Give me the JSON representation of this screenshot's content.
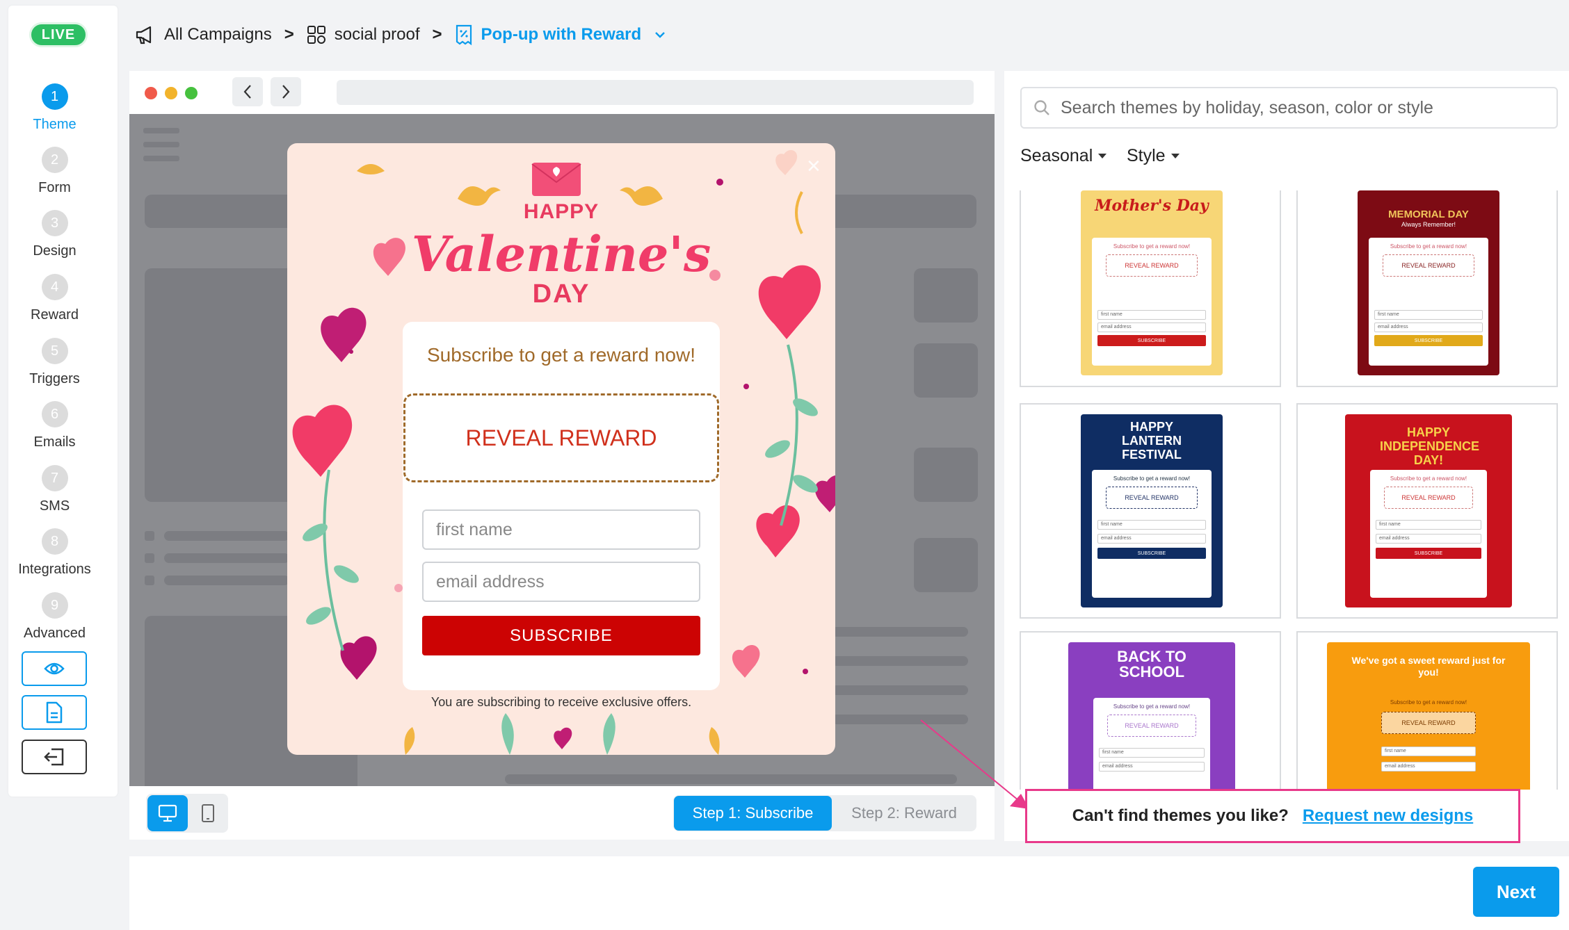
{
  "status_badge": "LIVE",
  "steps": [
    {
      "num": "1",
      "label": "Theme"
    },
    {
      "num": "2",
      "label": "Form"
    },
    {
      "num": "3",
      "label": "Design"
    },
    {
      "num": "4",
      "label": "Reward"
    },
    {
      "num": "5",
      "label": "Triggers"
    },
    {
      "num": "6",
      "label": "Emails"
    },
    {
      "num": "7",
      "label": "SMS"
    },
    {
      "num": "8",
      "label": "Integrations"
    },
    {
      "num": "9",
      "label": "Advanced"
    }
  ],
  "breadcrumb": {
    "all_campaigns": "All Campaigns",
    "folder": "social proof",
    "current": "Pop-up with Reward",
    "separator": ">"
  },
  "popup": {
    "headline_happy": "HAPPY",
    "headline_main": "Valentine's",
    "headline_day": "DAY",
    "subscribe_title": "Subscribe to get a reward now!",
    "reveal_label": "REVEAL REWARD",
    "first_name_placeholder": "first name",
    "email_placeholder": "email address",
    "subscribe_label": "SUBSCRIBE",
    "disclaimer": "You are subscribing to receive exclusive offers."
  },
  "step_tabs": {
    "step1": "Step 1: Subscribe",
    "step2": "Step 2: Reward"
  },
  "themes": {
    "search_placeholder": "Search themes by holiday, season, color or style",
    "filters": [
      "Seasonal",
      "Style"
    ],
    "cards": [
      {
        "title": "Mother's Day",
        "subtitle": "",
        "bg": "#f7d676",
        "accent": "#cc1b1b"
      },
      {
        "title": "MEMORIAL DAY",
        "subtitle": "Always Remember!",
        "bg": "#7d0b14",
        "accent": "#e1a91a"
      },
      {
        "title": "HAPPY LANTERN FESTIVAL",
        "subtitle": "",
        "bg": "#0f2d63",
        "accent": "#0f2d63"
      },
      {
        "title": "HAPPY INDEPENDENCE DAY!",
        "subtitle": "",
        "bg": "#c8121d",
        "accent": "#c8121d"
      },
      {
        "title": "BACK TO SCHOOL",
        "subtitle": "",
        "bg": "#8a3fc0",
        "accent": "#8a3fc0"
      },
      {
        "title": "We've got a sweet reward just for you!",
        "subtitle": "",
        "bg": "#f89c0e",
        "accent": "#c8121d"
      }
    ],
    "mini": {
      "subscribe": "Subscribe to get a reward now!",
      "reveal": "REVEAL REWARD",
      "first_name": "first name",
      "email": "email address",
      "button": "SUBSCRIBE",
      "disclaimer": "You are subscribing to receive exclusive offers."
    }
  },
  "request": {
    "prompt": "Can't find themes you like?",
    "link": "Request new designs"
  },
  "footer": {
    "next_label": "Next"
  },
  "colors": {
    "accent": "#0a9bec",
    "live": "#2dbf64",
    "highlight": "#e8398a",
    "subscribe_red": "#cc0303"
  }
}
